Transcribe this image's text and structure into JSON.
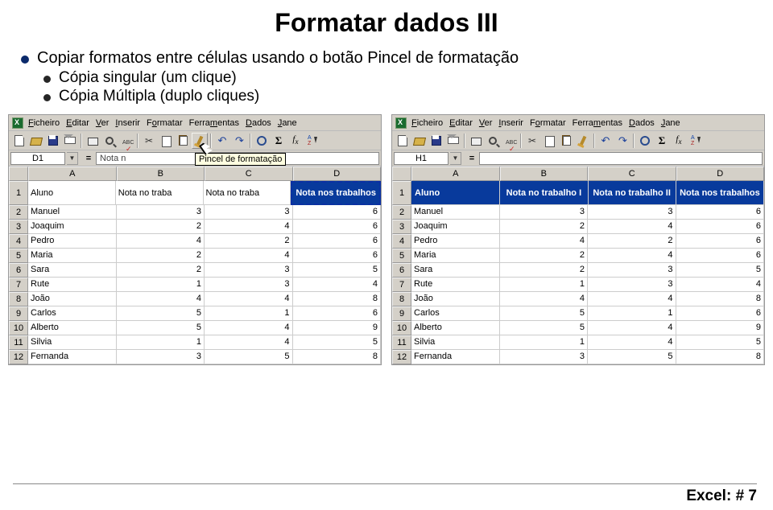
{
  "title": "Formatar dados III",
  "bullet_main": "Copiar formatos entre células usando o botão Pincel de formatação",
  "bullet_sub1": "Cópia singular (um clique)",
  "bullet_sub2": "Cópia Múltipla (duplo cliques)",
  "menu": {
    "ficheiro": "Ficheiro",
    "editar": "Editar",
    "ver": "Ver",
    "inserir": "Inserir",
    "formatar": "Formatar",
    "ferramentas": "Ferramentas",
    "dados": "Dados",
    "janela": "Jane"
  },
  "left": {
    "cell_ref": "D1",
    "formula_preview": "Nota n",
    "tooltip": "Pincel de formatação",
    "cols": [
      "A",
      "B",
      "C",
      "D"
    ],
    "header_row": [
      "Aluno",
      "Nota no traba",
      "Nota no traba",
      "Nota nos trabalhos"
    ],
    "rows": [
      {
        "n": "1"
      },
      {
        "n": "2",
        "a": "Manuel",
        "b": "3",
        "c": "3",
        "d": "6"
      },
      {
        "n": "3",
        "a": "Joaquim",
        "b": "2",
        "c": "4",
        "d": "6"
      },
      {
        "n": "4",
        "a": "Pedro",
        "b": "4",
        "c": "2",
        "d": "6"
      },
      {
        "n": "5",
        "a": "Maria",
        "b": "2",
        "c": "4",
        "d": "6"
      },
      {
        "n": "6",
        "a": "Sara",
        "b": "2",
        "c": "3",
        "d": "5"
      },
      {
        "n": "7",
        "a": "Rute",
        "b": "1",
        "c": "3",
        "d": "4"
      },
      {
        "n": "8",
        "a": "João",
        "b": "4",
        "c": "4",
        "d": "8"
      },
      {
        "n": "9",
        "a": "Carlos",
        "b": "5",
        "c": "1",
        "d": "6"
      },
      {
        "n": "10",
        "a": "Alberto",
        "b": "5",
        "c": "4",
        "d": "9"
      },
      {
        "n": "11",
        "a": "Silvia",
        "b": "1",
        "c": "4",
        "d": "5"
      },
      {
        "n": "12",
        "a": "Fernanda",
        "b": "3",
        "c": "5",
        "d": "8"
      }
    ]
  },
  "right": {
    "cell_ref": "H1",
    "formula_preview": "",
    "cols": [
      "A",
      "B",
      "C",
      "D"
    ],
    "header_row": [
      "Aluno",
      "Nota no trabalho I",
      "Nota no trabalho II",
      "Nota nos trabalhos"
    ],
    "rows": [
      {
        "n": "1"
      },
      {
        "n": "2",
        "a": "Manuel",
        "b": "3",
        "c": "3",
        "d": "6"
      },
      {
        "n": "3",
        "a": "Joaquim",
        "b": "2",
        "c": "4",
        "d": "6"
      },
      {
        "n": "4",
        "a": "Pedro",
        "b": "4",
        "c": "2",
        "d": "6"
      },
      {
        "n": "5",
        "a": "Maria",
        "b": "2",
        "c": "4",
        "d": "6"
      },
      {
        "n": "6",
        "a": "Sara",
        "b": "2",
        "c": "3",
        "d": "5"
      },
      {
        "n": "7",
        "a": "Rute",
        "b": "1",
        "c": "3",
        "d": "4"
      },
      {
        "n": "8",
        "a": "João",
        "b": "4",
        "c": "4",
        "d": "8"
      },
      {
        "n": "9",
        "a": "Carlos",
        "b": "5",
        "c": "1",
        "d": "6"
      },
      {
        "n": "10",
        "a": "Alberto",
        "b": "5",
        "c": "4",
        "d": "9"
      },
      {
        "n": "11",
        "a": "Silvia",
        "b": "1",
        "c": "4",
        "d": "5"
      },
      {
        "n": "12",
        "a": "Fernanda",
        "b": "3",
        "c": "5",
        "d": "8"
      }
    ]
  },
  "footer_label": "Excel: # ",
  "footer_page": "7"
}
